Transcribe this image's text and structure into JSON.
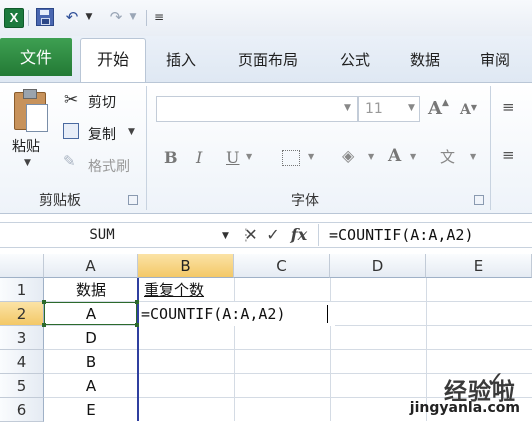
{
  "ribbon": {
    "tabs": [
      "文件",
      "开始",
      "插入",
      "页面布局",
      "公式",
      "数据",
      "审阅"
    ],
    "clipboard": {
      "paste": "粘贴",
      "cut": "剪切",
      "copy": "复制",
      "format_painter": "格式刷",
      "group_label": "剪贴板"
    },
    "font": {
      "font_size": "11",
      "bold": "B",
      "italic": "I",
      "underline": "U",
      "group_label": "字体"
    }
  },
  "formula_bar": {
    "name_box": "SUM",
    "formula": "=COUNTIF(A:A,A2)",
    "fx": "fx"
  },
  "sheet": {
    "columns": [
      "A",
      "B",
      "C",
      "D",
      "E"
    ],
    "rows": [
      "1",
      "2",
      "3",
      "4",
      "5",
      "6"
    ],
    "active_column": "B",
    "active_row": "2",
    "cells": {
      "A1": "数据",
      "B1": "重复个数",
      "A2": "A",
      "B2": "=COUNTIF(A:A,A2)",
      "A3": "D",
      "A4": "B",
      "A5": "A",
      "A6": "E"
    }
  },
  "watermark": {
    "text": "经验啦",
    "url": "jingyanla.com"
  },
  "colors": {
    "file_tab": "#2e8b45",
    "selected_header": "#f5cd6e",
    "range_border": "#2c6a2c"
  }
}
